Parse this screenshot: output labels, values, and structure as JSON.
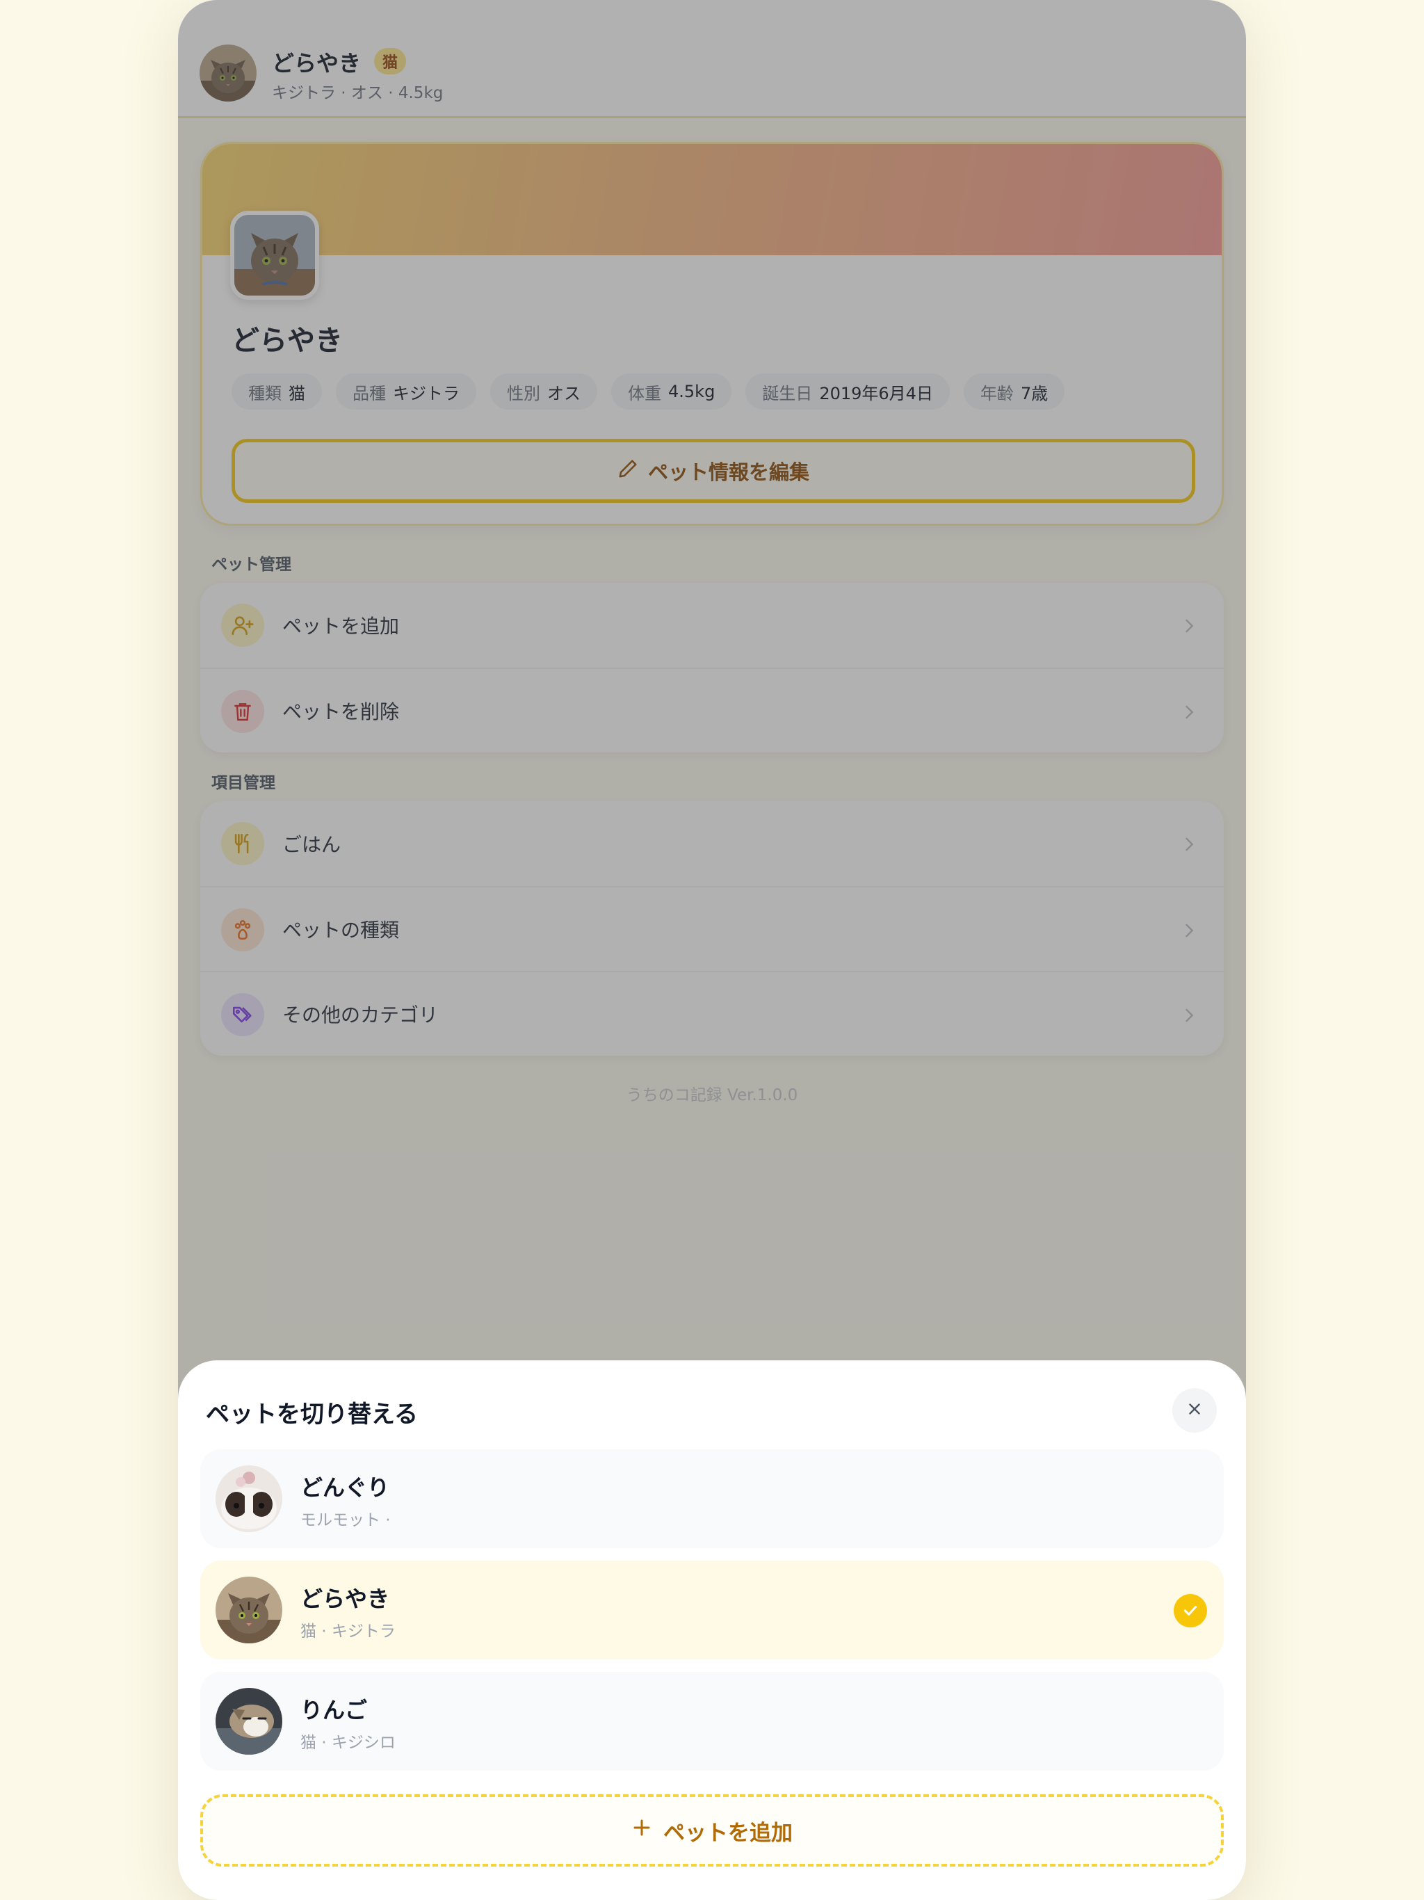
{
  "header": {
    "name": "どらやき",
    "badge": "猫",
    "subtitle": "キジトラ · オス · 4.5kg"
  },
  "profile": {
    "name": "どらやき",
    "chips": [
      {
        "key": "種類",
        "value": "猫"
      },
      {
        "key": "品種",
        "value": "キジトラ"
      },
      {
        "key": "性別",
        "value": "オス"
      },
      {
        "key": "体重",
        "value": "4.5kg"
      },
      {
        "key": "誕生日",
        "value": "2019年6月4日"
      },
      {
        "key": "年齢",
        "value": "7歳"
      }
    ],
    "edit_label": "ペット情報を編集"
  },
  "pet_management": {
    "title": "ペット管理",
    "items": [
      {
        "label": "ペットを追加",
        "icon": "user-plus-icon"
      },
      {
        "label": "ペットを削除",
        "icon": "trash-icon"
      }
    ]
  },
  "item_management": {
    "title": "項目管理",
    "items": [
      {
        "label": "ごはん",
        "icon": "utensils-icon"
      },
      {
        "label": "ペットの種類",
        "icon": "paw-icon"
      },
      {
        "label": "その他のカテゴリ",
        "icon": "tags-icon"
      }
    ]
  },
  "version": "うちのコ記録 Ver.1.0.0",
  "switcher": {
    "title": "ペットを切り替える",
    "pets": [
      {
        "name": "どんぐり",
        "sub": "モルモット ·",
        "selected": false
      },
      {
        "name": "どらやき",
        "sub": "猫 · キジトラ",
        "selected": true
      },
      {
        "name": "りんご",
        "sub": "猫 · キジシロ",
        "selected": false
      }
    ],
    "add_label": "ペットを追加"
  },
  "colors": {
    "accent": "#f7c609",
    "accent_text": "#8a4b07",
    "background": "#fcf9e8",
    "danger": "#dc2626"
  }
}
